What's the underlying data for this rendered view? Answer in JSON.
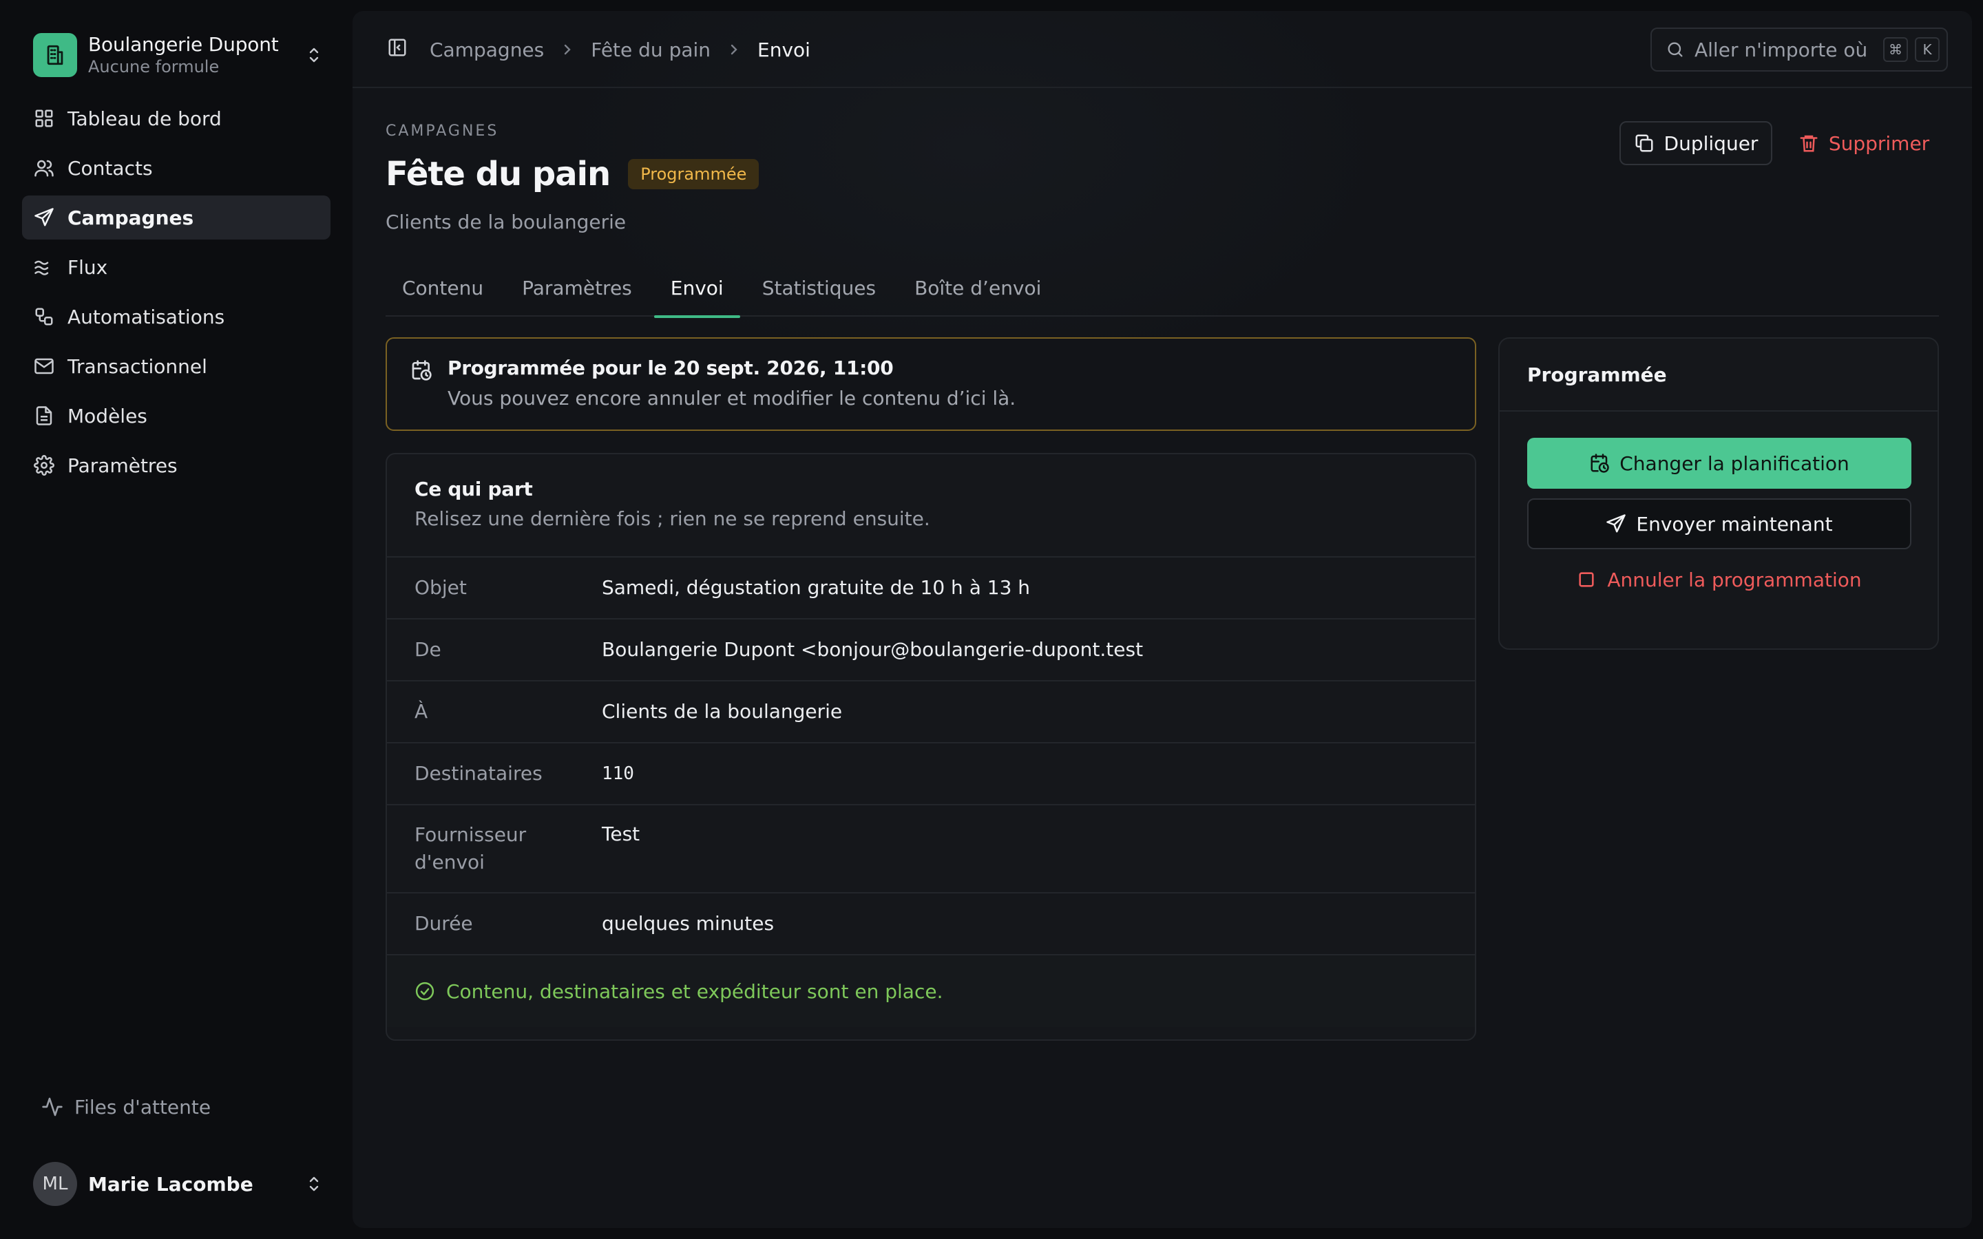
{
  "org": {
    "name": "Boulangerie Dupont",
    "plan": "Aucune formule"
  },
  "nav": [
    {
      "label": "Tableau de bord",
      "icon": "dashboard-icon"
    },
    {
      "label": "Contacts",
      "icon": "users-icon"
    },
    {
      "label": "Campagnes",
      "icon": "send-icon",
      "active": true
    },
    {
      "label": "Flux",
      "icon": "waves-icon"
    },
    {
      "label": "Automatisations",
      "icon": "workflow-icon"
    },
    {
      "label": "Transactionnel",
      "icon": "mail-icon"
    },
    {
      "label": "Modèles",
      "icon": "file-text-icon"
    },
    {
      "label": "Paramètres",
      "icon": "gear-icon"
    }
  ],
  "queues_label": "Files d'attente",
  "user": {
    "initials": "ML",
    "name": "Marie Lacombe"
  },
  "breadcrumb": [
    "Campagnes",
    "Fête du pain",
    "Envoi"
  ],
  "search": {
    "placeholder": "Aller n'importe où",
    "kbd1": "⌘",
    "kbd2": "K"
  },
  "header": {
    "eyebrow": "CAMPAGNES",
    "title": "Fête du pain",
    "status": "Programmée",
    "subtitle": "Clients de la boulangerie",
    "duplicate": "Dupliquer",
    "delete": "Supprimer"
  },
  "tabs": [
    {
      "label": "Contenu"
    },
    {
      "label": "Paramètres"
    },
    {
      "label": "Envoi",
      "active": true
    },
    {
      "label": "Statistiques"
    },
    {
      "label": "Boîte d’envoi"
    }
  ],
  "alert": {
    "title": "Programmée pour le 20 sept. 2026, 11:00",
    "text": "Vous pouvez encore annuler et modifier le contenu d’ici là."
  },
  "summary": {
    "title": "Ce qui part",
    "subtitle": "Relisez une dernière fois ; rien ne se reprend ensuite.",
    "rows": [
      {
        "key": "Objet",
        "value": "Samedi, dégustation gratuite de 10 h à 13 h"
      },
      {
        "key": "De",
        "value": "Boulangerie Dupont <bonjour@boulangerie-dupont.test"
      },
      {
        "key": "À",
        "value": "Clients de la boulangerie"
      },
      {
        "key": "Destinataires",
        "value": "110"
      },
      {
        "key": "Fournisseur d'envoi",
        "value": "Test"
      },
      {
        "key": "Durée",
        "value": "quelques minutes"
      }
    ],
    "check": "Contenu, destinataires et expéditeur sont en place."
  },
  "schedule_panel": {
    "title": "Programmée",
    "change": "Changer la planification",
    "send_now": "Envoyer maintenant",
    "cancel": "Annuler la programmation"
  },
  "colors": {
    "accent": "#4cc792",
    "danger": "#ef5b5b",
    "warning": "#f1b84a",
    "success": "#7ec85a"
  }
}
